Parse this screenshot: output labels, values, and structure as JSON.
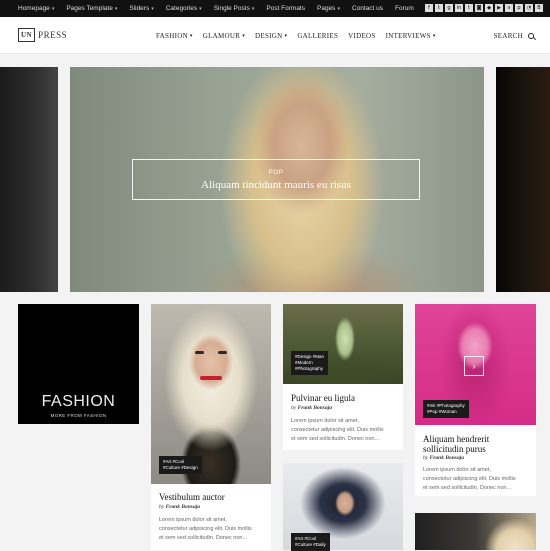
{
  "topbar": {
    "menu": [
      {
        "label": "Homepage",
        "has_caret": true
      },
      {
        "label": "Pages Template",
        "has_caret": true
      },
      {
        "label": "Sliders",
        "has_caret": true
      },
      {
        "label": "Categories",
        "has_caret": true
      },
      {
        "label": "Single Posts",
        "has_caret": true
      },
      {
        "label": "Post Formats",
        "has_caret": false
      },
      {
        "label": "Pages",
        "has_caret": true
      },
      {
        "label": "Contact us",
        "has_caret": false
      },
      {
        "label": "Forum",
        "has_caret": false
      }
    ],
    "social_icons": [
      "facebook-icon",
      "twitter-icon",
      "google-plus-icon",
      "linkedin-icon",
      "tumblr-icon",
      "instagram-icon",
      "dropbox-icon",
      "youtube-icon",
      "vimeo-icon",
      "pinterest-icon",
      "rss-icon",
      "behance-icon"
    ]
  },
  "header": {
    "logo_box": "UN",
    "logo_text": "PRESS",
    "nav": [
      {
        "label": "FASHION",
        "has_caret": true
      },
      {
        "label": "GLAMOUR",
        "has_caret": true
      },
      {
        "label": "DESIGN",
        "has_caret": true
      },
      {
        "label": "GALLERIES",
        "has_caret": false
      },
      {
        "label": "VIDEOS",
        "has_caret": false
      },
      {
        "label": "INTERVIEWS",
        "has_caret": true
      }
    ],
    "search_label": "SEARCH"
  },
  "hero": {
    "category": "POP",
    "title": "Aliquam tincidunt mauris eu risus"
  },
  "fashion_box": {
    "title": "FASHION",
    "subtitle": "MORE FROM FASHION"
  },
  "cards": [
    {
      "tags": [
        "#Art #Cool",
        "#Culture #Design"
      ],
      "title": "Vestibulum auctor",
      "author_prefix": "by",
      "author": "Frank Bonsaja",
      "excerpt": [
        "Lorem ipsum dolor sit amet,",
        "consectetur adipiscing elit. Duis mollis",
        "et sem sed sollicitudin. Donec non..."
      ]
    },
    {
      "tags": [
        "#Design #Man",
        "#Modern",
        "#Photography"
      ],
      "title": "Pulvinar eu ligula",
      "author_prefix": "by",
      "author": "Frank Bonsaja",
      "excerpt": [
        "Lorem ipsum dolor sit amet,",
        "consectetur adipiscing elit. Duis mollis",
        "et sem sed sollicitudin. Donec non..."
      ]
    },
    {
      "tags": [
        "#Art #Cool",
        "#Culture #Daily"
      ]
    },
    {
      "tags": [
        "#Ink #Photography",
        "#Pop #Woman"
      ],
      "title_lines": [
        "Aliquam hendrerit",
        "sollicitudin purus"
      ],
      "author_prefix": "by",
      "author": "Frank Bonsaja",
      "excerpt": [
        "Lorem ipsum dolor sit amet,",
        "consectetur adipiscing elit. Duis mollis",
        "et sem sed sollicitudin. Donec non..."
      ],
      "arrow": "›"
    }
  ]
}
